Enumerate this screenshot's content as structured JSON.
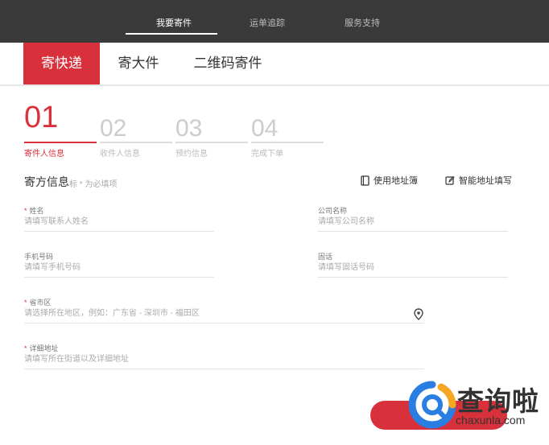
{
  "top_nav": {
    "items": [
      {
        "label": "我要寄件",
        "active": true
      },
      {
        "label": "运单追踪",
        "active": false
      },
      {
        "label": "服务支持",
        "active": false
      }
    ]
  },
  "tabs": [
    {
      "label": "寄快递",
      "active": true
    },
    {
      "label": "寄大件",
      "active": false
    },
    {
      "label": "二维码寄件",
      "active": false
    }
  ],
  "steps": [
    {
      "num": "01",
      "label": "寄件人信息",
      "active": true
    },
    {
      "num": "02",
      "label": "收件人信息",
      "active": false
    },
    {
      "num": "03",
      "label": "预约信息",
      "active": false
    },
    {
      "num": "04",
      "label": "完成下单",
      "active": false
    }
  ],
  "section": {
    "title": "寄方信息",
    "note": "标 * 为必填项",
    "address_book_label": "使用地址簿",
    "smart_fill_label": "智能地址填写"
  },
  "fields": {
    "name": {
      "label": "姓名",
      "required": true,
      "placeholder": "请填写联系人姓名",
      "value": ""
    },
    "company": {
      "label": "公司名称",
      "required": false,
      "placeholder": "请填写公司名称",
      "value": ""
    },
    "mobile": {
      "label": "手机号码",
      "required": false,
      "placeholder": "请填写手机号码",
      "value": ""
    },
    "phone": {
      "label": "固话",
      "required": false,
      "placeholder": "请填写固话号码",
      "value": ""
    },
    "region": {
      "label": "省市区",
      "required": true,
      "placeholder": "请选择所在地区，例如：广东省 - 深圳市 - 福田区",
      "value": ""
    },
    "address": {
      "label": "详细地址",
      "required": true,
      "placeholder": "请填写所在街道以及详细地址",
      "value": ""
    }
  },
  "watermark": {
    "cn": "查询啦",
    "en": "chaxunla.com"
  },
  "colors": {
    "accent": "#d9313b",
    "topbar": "#3a3a3a"
  }
}
